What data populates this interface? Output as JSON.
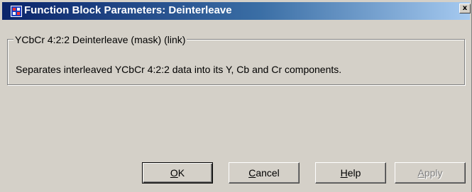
{
  "window": {
    "title": "Function Block Parameters: Deinterleave",
    "close_label": "x",
    "app_icon": "simulink-block-icon"
  },
  "group": {
    "legend": "YCbCr 4:2:2 Deinterleave (mask) (link)",
    "description": "Separates interleaved YCbCr 4:2:2 data into its Y, Cb and Cr components."
  },
  "buttons": {
    "ok": {
      "accel": "O",
      "rest": "K"
    },
    "cancel": {
      "accel": "C",
      "rest": "ancel"
    },
    "help": {
      "accel": "H",
      "rest": "elp"
    },
    "apply": {
      "accel": "A",
      "rest": "pply",
      "enabled": false
    }
  },
  "colors": {
    "titlebar_start": "#0a246a",
    "titlebar_end": "#a6caf0",
    "face": "#d4d0c8"
  }
}
